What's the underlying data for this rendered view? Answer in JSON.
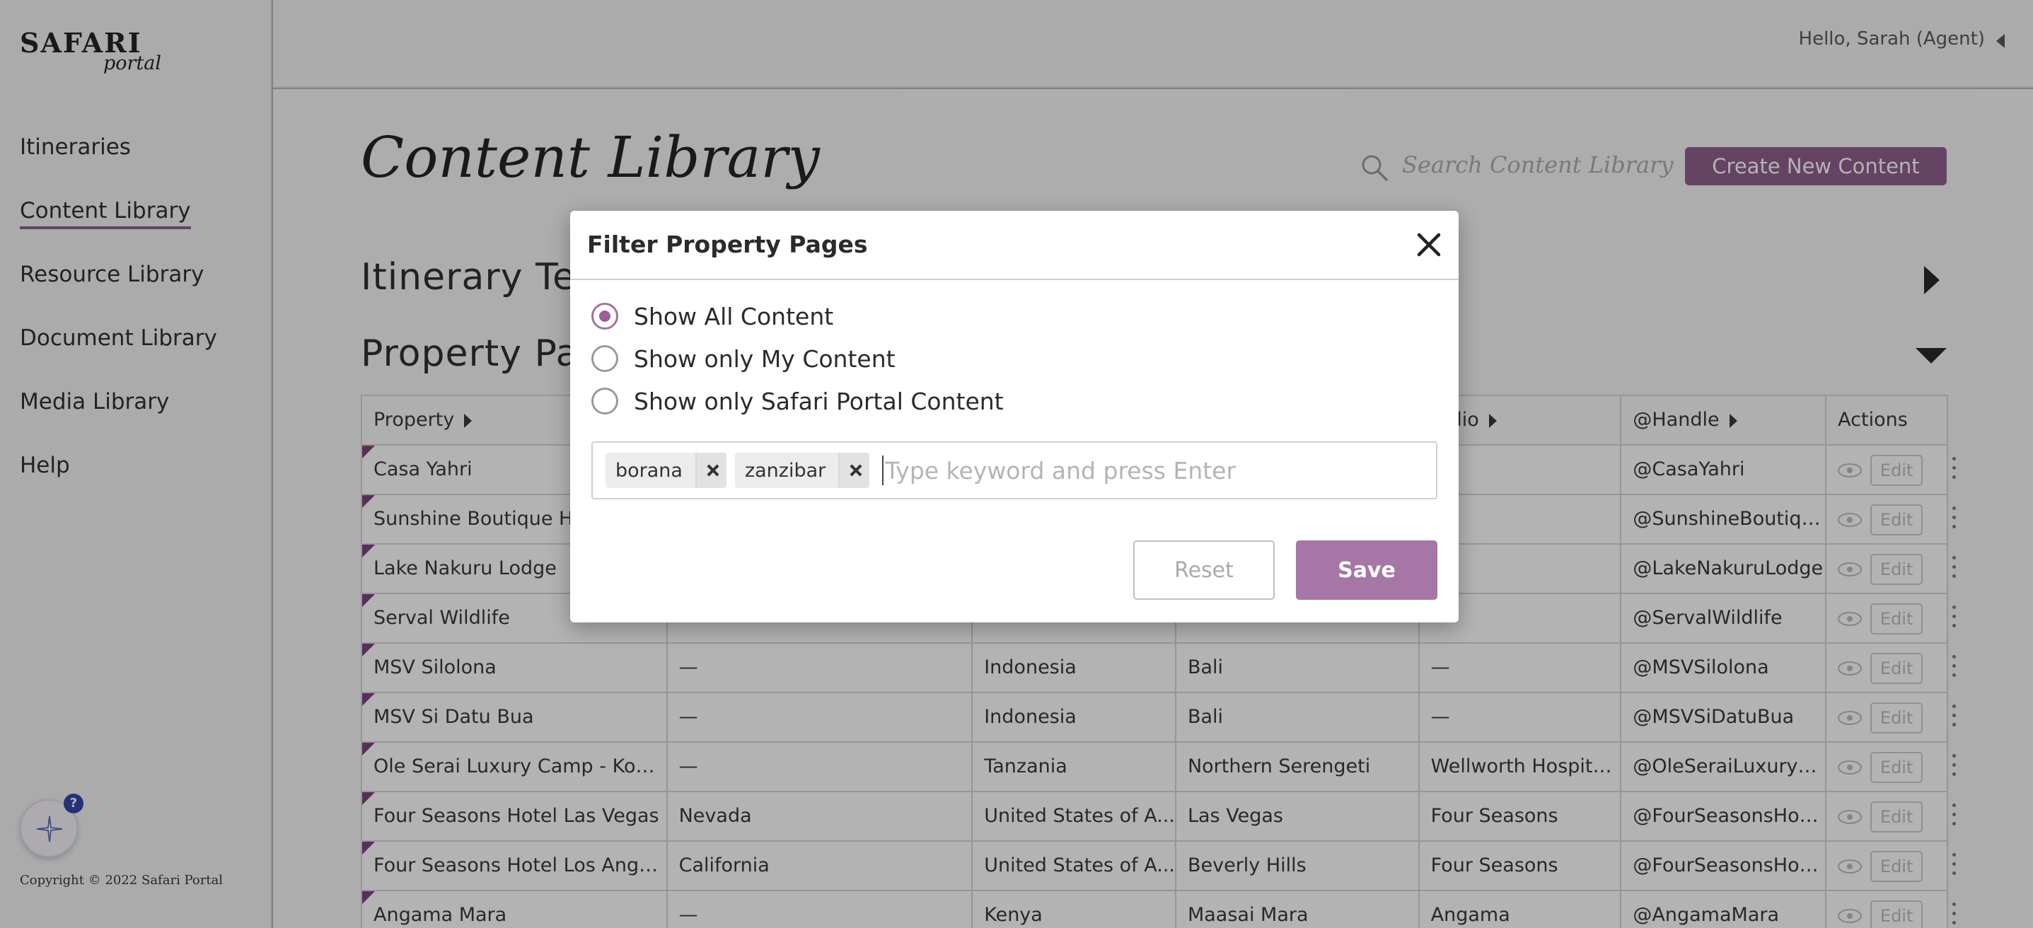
{
  "sidebar": {
    "logo_main": "SAFARI",
    "logo_sub": "portal",
    "items": [
      {
        "label": "Itineraries"
      },
      {
        "label": "Content Library"
      },
      {
        "label": "Resource Library"
      },
      {
        "label": "Document Library"
      },
      {
        "label": "Media Library"
      },
      {
        "label": "Help"
      }
    ],
    "active": "Content Library",
    "help_badge": "?",
    "copyright": "Copyright © 2022 Safari Portal"
  },
  "header": {
    "greeting": "Hello, Sarah (Agent)"
  },
  "main": {
    "title": "Content Library",
    "search_placeholder": "Search Content Library",
    "create_button": "Create New Content",
    "sections": [
      {
        "label": "Itinerary Tem",
        "expanded": false
      },
      {
        "label": "Property Pag",
        "expanded": true
      }
    ]
  },
  "table": {
    "columns": [
      "Property",
      "",
      "",
      "",
      "tfolio",
      "@Handle",
      "Actions"
    ],
    "rows": [
      {
        "property": "Casa Yahri",
        "region": "",
        "country": "",
        "area": "",
        "portfolio": "",
        "handle": "@CasaYahri"
      },
      {
        "property": "Sunshine Boutique Hote",
        "region": "",
        "country": "",
        "area": "",
        "portfolio": "",
        "handle": "@SunshineBoutiqu..."
      },
      {
        "property": "Lake Nakuru Lodge",
        "region": "",
        "country": "",
        "area": "",
        "portfolio": "",
        "handle": "@LakeNakuruLodge"
      },
      {
        "property": "Serval Wildlife",
        "region": "",
        "country": "",
        "area": "",
        "portfolio": "",
        "handle": "@ServalWildlife"
      },
      {
        "property": "MSV Silolona",
        "region": "—",
        "country": "Indonesia",
        "area": "Bali",
        "portfolio": "—",
        "handle": "@MSVSilolona"
      },
      {
        "property": "MSV Si Datu Bua",
        "region": "—",
        "country": "Indonesia",
        "area": "Bali",
        "portfolio": "—",
        "handle": "@MSVSiDatuBua"
      },
      {
        "property": "Ole Serai Luxury Camp - Kogat...",
        "region": "—",
        "country": "Tanzania",
        "area": "Northern Serengeti",
        "portfolio": "Wellworth Hospitali...",
        "handle": "@OleSeraiLuxuryC..."
      },
      {
        "property": "Four Seasons Hotel Las Vegas",
        "region": "Nevada",
        "country": "United States of A...",
        "area": "Las Vegas",
        "portfolio": "Four Seasons",
        "handle": "@FourSeasonsHote..."
      },
      {
        "property": "Four Seasons Hotel Los Angeles...",
        "region": "California",
        "country": "United States of A...",
        "area": "Beverly Hills",
        "portfolio": "Four Seasons",
        "handle": "@FourSeasonsHote..."
      },
      {
        "property": "Angama Mara",
        "region": "—",
        "country": "Kenya",
        "area": "Maasai Mara",
        "portfolio": "Angama",
        "handle": "@AngamaMara"
      }
    ],
    "edit_label": "Edit"
  },
  "modal": {
    "title": "Filter Property Pages",
    "options": [
      {
        "label": "Show All Content",
        "checked": true
      },
      {
        "label": "Show only My Content",
        "checked": false
      },
      {
        "label": "Show only Safari Portal Content",
        "checked": false
      }
    ],
    "tags": [
      "borana",
      "zanzibar"
    ],
    "keyword_placeholder": "Type keyword and press Enter",
    "reset_label": "Reset",
    "save_label": "Save"
  },
  "colors": {
    "accent": "#8c5a88",
    "save_button": "#a676a6"
  }
}
